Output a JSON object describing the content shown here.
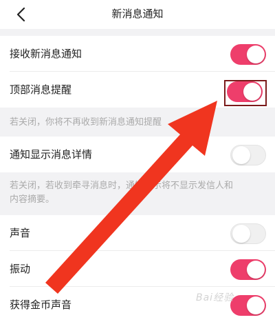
{
  "header": {
    "title": "新消息通知",
    "back_icon": "chevron-left-icon"
  },
  "settings": [
    {
      "label": "接收新消息通知",
      "on": true
    },
    {
      "label": "顶部消息提醒",
      "on": true
    },
    {
      "label": "通知显示消息详情",
      "on": false
    },
    {
      "label": "声音",
      "on": false
    },
    {
      "label": "振动",
      "on": true
    },
    {
      "label": "获得金币声音",
      "on": true
    }
  ],
  "notes": {
    "top_banner": "若关闭，你将不再收到新消息通知提醒",
    "details_line1": "若关闭，若收到牵寻消息时，通知提示将不显示发信人和",
    "details_line2": "内容摘要。"
  },
  "colors": {
    "accent": "#ee3e6b",
    "annotation_arrow": "#f0351f",
    "highlight_box": "#7a1a1a"
  },
  "watermark": "Bai经验"
}
